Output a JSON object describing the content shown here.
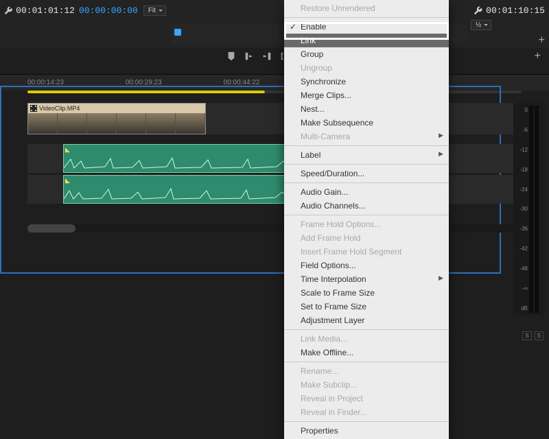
{
  "source_tc": "00:01:01:12",
  "program_tc": "00:01:10:15",
  "sequence_tc": "00:00:00:00",
  "fit_label": "Fit",
  "fit_alt": "½",
  "ruler_marks": [
    "00:00:14:23",
    "00:00:29:23",
    "00:00:44:22"
  ],
  "clip_name": "VideoClip.MP4",
  "meter_labels": [
    "0",
    "-6",
    "-12",
    "-18",
    "-24",
    "-30",
    "-36",
    "-42",
    "-48",
    "-∞",
    "dB"
  ],
  "meter_btns": [
    "S",
    "S"
  ],
  "ctx": {
    "restore": "Restore Unrendered",
    "enable": "Enable",
    "link": "Link",
    "group": "Group",
    "ungroup": "Ungroup",
    "synchronize": "Synchronize",
    "merge": "Merge Clips...",
    "nest": "Nest...",
    "make_sub": "Make Subsequence",
    "multicam": "Multi-Camera",
    "label": "Label",
    "speed": "Speed/Duration...",
    "audio_gain": "Audio Gain...",
    "audio_ch": "Audio Channels...",
    "frame_hold_opt": "Frame Hold Options...",
    "add_frame_hold": "Add Frame Hold",
    "insert_fh_seg": "Insert Frame Hold Segment",
    "field_opt": "Field Options...",
    "time_interp": "Time Interpolation",
    "scale_frame": "Scale to Frame Size",
    "set_frame": "Set to Frame Size",
    "adj_layer": "Adjustment Layer",
    "link_media": "Link Media...",
    "make_offline": "Make Offline...",
    "rename": "Rename...",
    "make_subclip": "Make Subclip...",
    "reveal_proj": "Reveal in Project",
    "reveal_finder": "Reveal in Finder...",
    "properties": "Properties"
  }
}
